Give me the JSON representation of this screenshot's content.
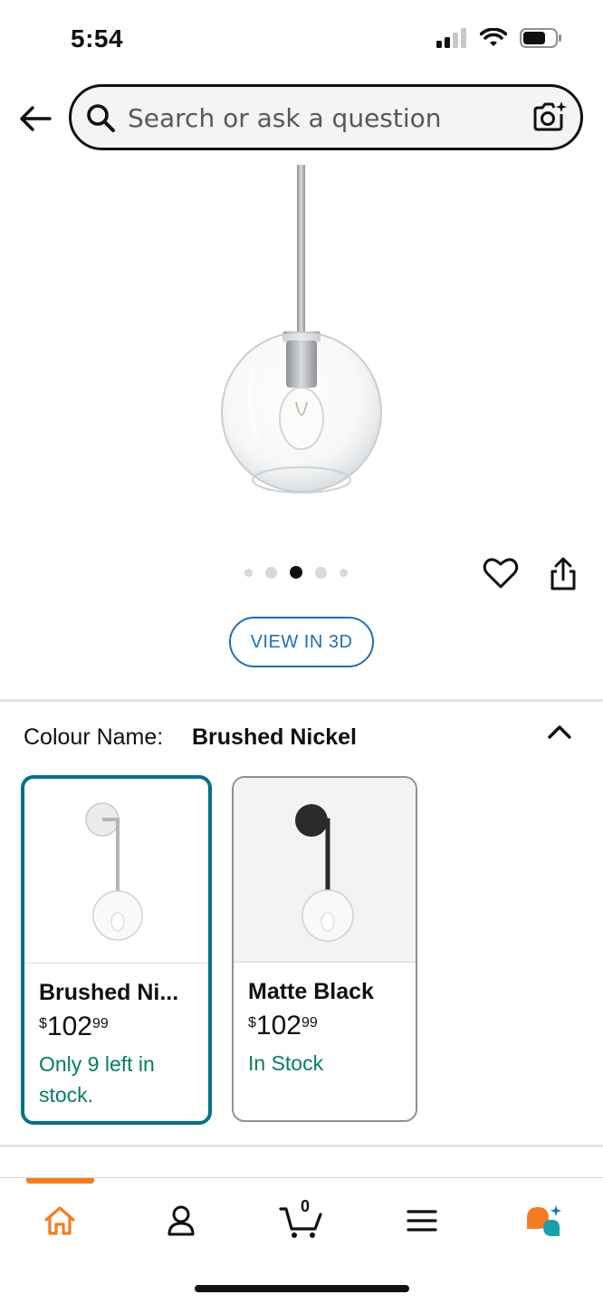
{
  "status_bar": {
    "time": "5:54",
    "signal_icon": "cellular-signal-icon",
    "wifi_icon": "wifi-icon",
    "battery_icon": "battery-icon"
  },
  "header": {
    "back_icon": "back-arrow-icon",
    "search": {
      "placeholder": "Search or ask a question",
      "search_icon": "search-icon",
      "camera_icon": "camera-lens-icon"
    }
  },
  "product": {
    "image_description_icon": "pendant-light-image",
    "carousel": {
      "count": 5,
      "active_index": 3
    },
    "wishlist_icon": "heart-icon",
    "share_icon": "share-icon",
    "view_3d_label": "VIEW IN 3D"
  },
  "variations": {
    "label": "Colour Name:",
    "selected_value": "Brushed Nickel",
    "collapse_icon": "chevron-up-icon",
    "options": [
      {
        "title": "Brushed Ni...",
        "price_symbol": "$",
        "price_whole": "102",
        "price_fraction": "99",
        "stock": "Only 9 left in stock.",
        "selected": true
      },
      {
        "title": "Matte Black",
        "price_symbol": "$",
        "price_whole": "102",
        "price_fraction": "99",
        "stock": "In Stock",
        "selected": false
      }
    ]
  },
  "bottom_nav": {
    "items": [
      {
        "icon": "home-icon",
        "active": true
      },
      {
        "icon": "account-icon",
        "active": false
      },
      {
        "icon": "cart-icon",
        "count": "0",
        "active": false
      },
      {
        "icon": "menu-icon",
        "active": false
      },
      {
        "icon": "rufus-assistant-icon",
        "active": false
      }
    ]
  },
  "colors": {
    "accent_orange": "#f47d23",
    "selected_border": "#007185",
    "stock_green": "#067d62",
    "link_blue": "#1f6fb2"
  }
}
